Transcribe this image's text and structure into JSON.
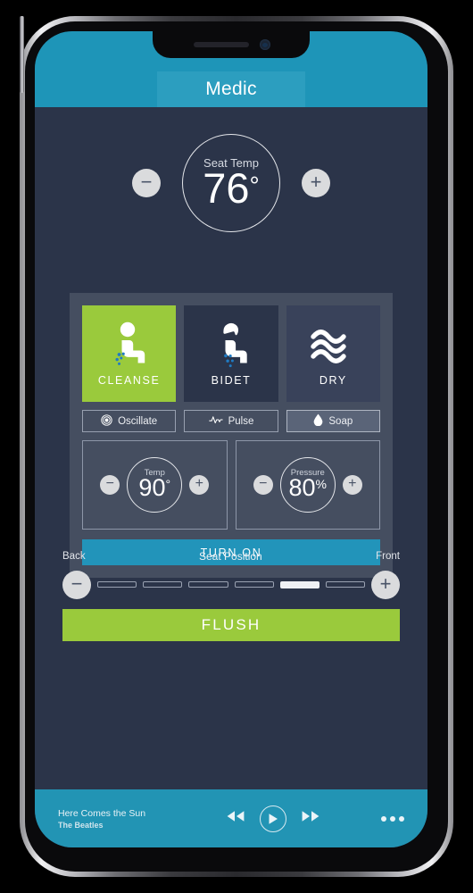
{
  "app": {
    "title": "Medic"
  },
  "seat_temp": {
    "label": "Seat Temp",
    "value": "76",
    "unit": "°",
    "decrease_label": "−",
    "increase_label": "+"
  },
  "modes": [
    {
      "id": "cleanse",
      "label": "CLEANSE",
      "icon": "seated-person-spray-icon",
      "active": true,
      "color": "#9ACA3C"
    },
    {
      "id": "bidet",
      "label": "BIDET",
      "icon": "seated-person-bidet-icon",
      "active": false,
      "color": "#2B3449"
    },
    {
      "id": "dry",
      "label": "DRY",
      "icon": "air-waves-icon",
      "active": false,
      "color": "#39425A"
    }
  ],
  "options": [
    {
      "id": "oscillate",
      "label": "Oscillate",
      "icon": "concentric-circles-icon",
      "active": false
    },
    {
      "id": "pulse",
      "label": "Pulse",
      "icon": "waveform-icon",
      "active": false
    },
    {
      "id": "soap",
      "label": "Soap",
      "icon": "water-drop-icon",
      "active": true
    }
  ],
  "temp_dial": {
    "label": "Temp",
    "value": "90",
    "unit": "°",
    "decrease_label": "−",
    "increase_label": "+"
  },
  "pressure_dial": {
    "label": "Pressure",
    "value": "80",
    "unit": "%",
    "decrease_label": "−",
    "increase_label": "+"
  },
  "turn_on": {
    "label": "TURN ON"
  },
  "seat_position": {
    "title": "Seat Position",
    "back_label": "Back",
    "front_label": "Front",
    "decrease_label": "−",
    "increase_label": "+",
    "segments": 6,
    "selected_index": 4
  },
  "flush": {
    "label": "FLUSH"
  },
  "player": {
    "track_title": "Here Comes the Sun",
    "track_artist": "The Beatles",
    "prev_icon": "rewind-icon",
    "play_icon": "play-icon",
    "next_icon": "fast-forward-icon",
    "more_icon": "more-options-icon"
  },
  "colors": {
    "header_teal": "#1E95B8",
    "body_navy": "#2B3449",
    "panel_slate": "#454E60",
    "accent_green": "#9ACA3C",
    "accent_blue": "#2294BA",
    "light_gray": "#DADBDD"
  }
}
